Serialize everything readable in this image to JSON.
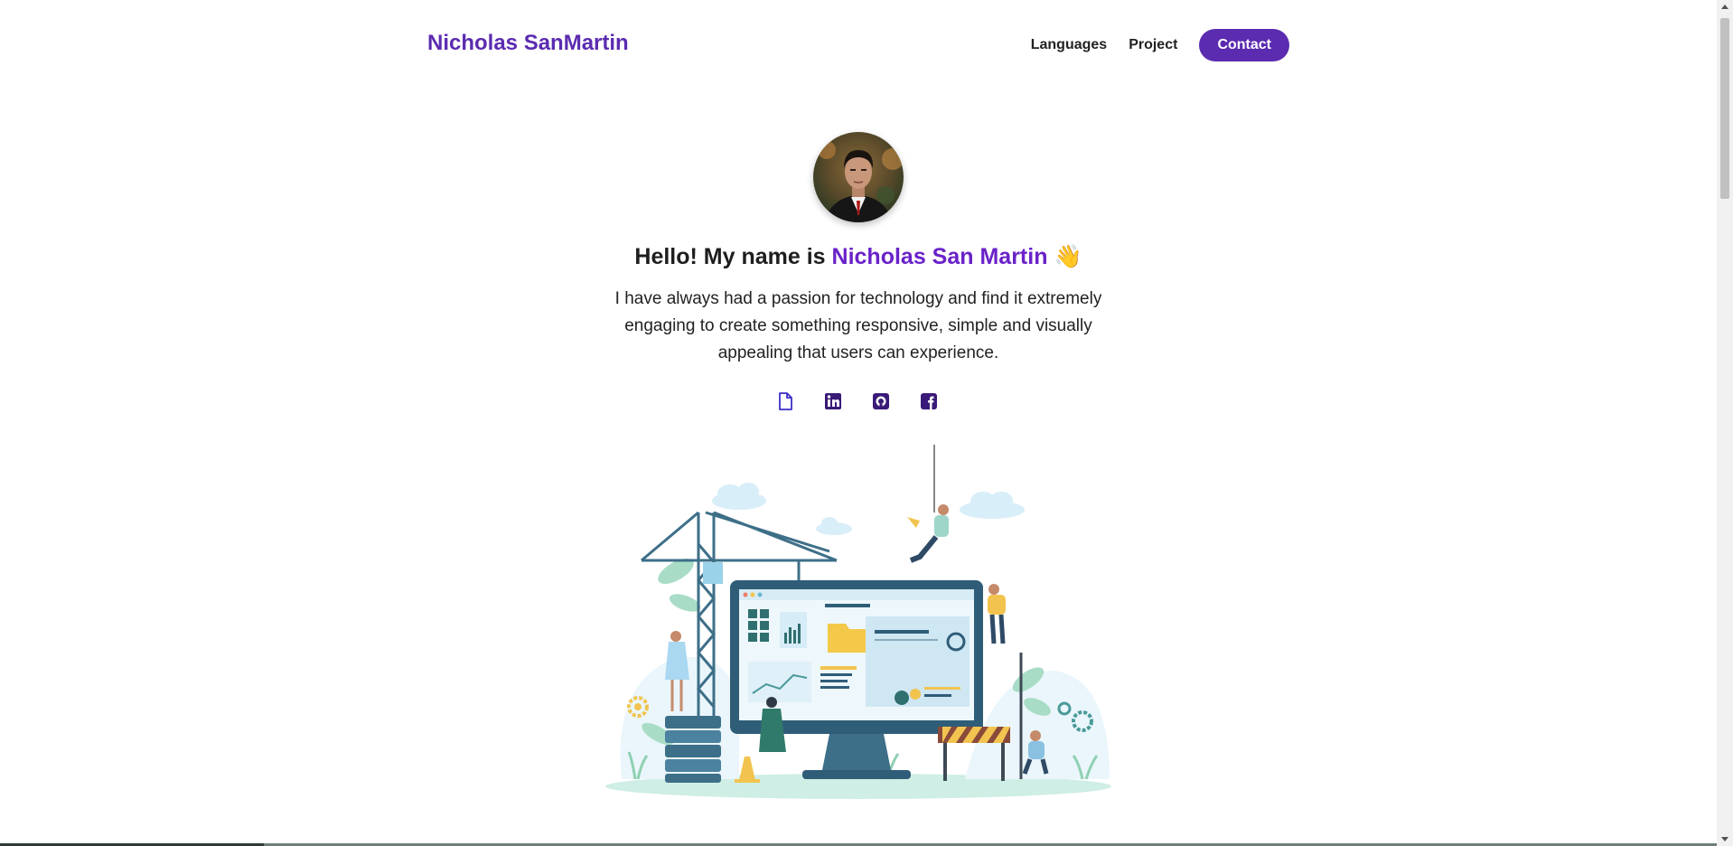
{
  "nav": {
    "brand": "Nicholas SanMartin",
    "links": [
      "Languages",
      "Project"
    ],
    "contact_label": "Contact"
  },
  "hero": {
    "greeting_prefix": "Hello! My name is ",
    "greeting_name": "Nicholas San Martin",
    "greeting_emoji": "👋",
    "bio": "I have always had a passion for technology and find it extremely engaging to create something responsive, simple and visually appealing that users can experience."
  },
  "socials": [
    {
      "icon": "file-icon"
    },
    {
      "icon": "linkedin-icon"
    },
    {
      "icon": "github-icon"
    },
    {
      "icon": "facebook-icon"
    }
  ],
  "colors": {
    "accent": "#5b2bb0",
    "highlight": "#6a22c9",
    "text": "#222222"
  }
}
